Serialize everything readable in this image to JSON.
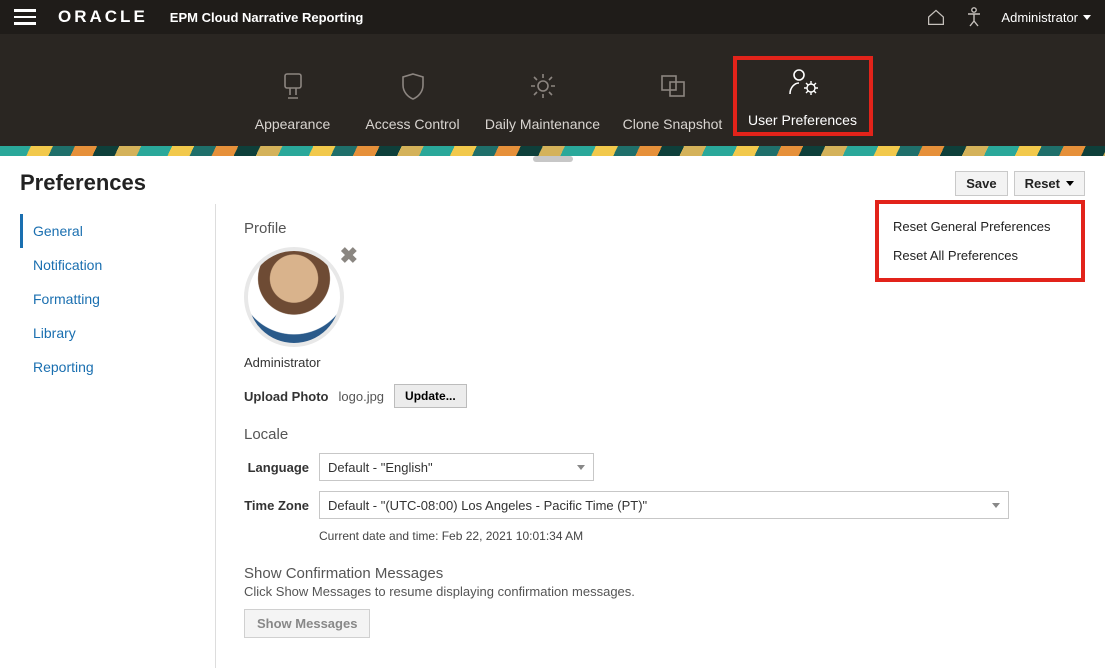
{
  "header": {
    "logo_text": "ORACLE",
    "app_title": "EPM Cloud Narrative Reporting",
    "user_label": "Administrator"
  },
  "nav": {
    "tabs": [
      {
        "label": "Appearance"
      },
      {
        "label": "Access Control"
      },
      {
        "label": "Daily Maintenance"
      },
      {
        "label": "Clone Snapshot"
      },
      {
        "label": "User Preferences"
      }
    ]
  },
  "page": {
    "title": "Preferences",
    "save_label": "Save",
    "reset_label": "Reset",
    "reset_menu": {
      "general": "Reset General Preferences",
      "all": "Reset All Preferences"
    }
  },
  "side": {
    "items": [
      {
        "label": "General"
      },
      {
        "label": "Notification"
      },
      {
        "label": "Formatting"
      },
      {
        "label": "Library"
      },
      {
        "label": "Reporting"
      }
    ]
  },
  "profile": {
    "section_title": "Profile",
    "display_name": "Administrator",
    "upload_label": "Upload Photo",
    "file_name": "logo.jpg",
    "update_label": "Update..."
  },
  "locale": {
    "section_title": "Locale",
    "language_label": "Language",
    "language_value": "Default - \"English\"",
    "timezone_label": "Time Zone",
    "timezone_value": "Default - \"(UTC-08:00) Los Angeles - Pacific Time (PT)\"",
    "current_time_label": "Current date and time: Feb 22, 2021 10:01:34 AM"
  },
  "confirm": {
    "title": "Show Confirmation Messages",
    "subtitle": "Click Show Messages to resume displaying confirmation messages.",
    "button_label": "Show Messages"
  }
}
